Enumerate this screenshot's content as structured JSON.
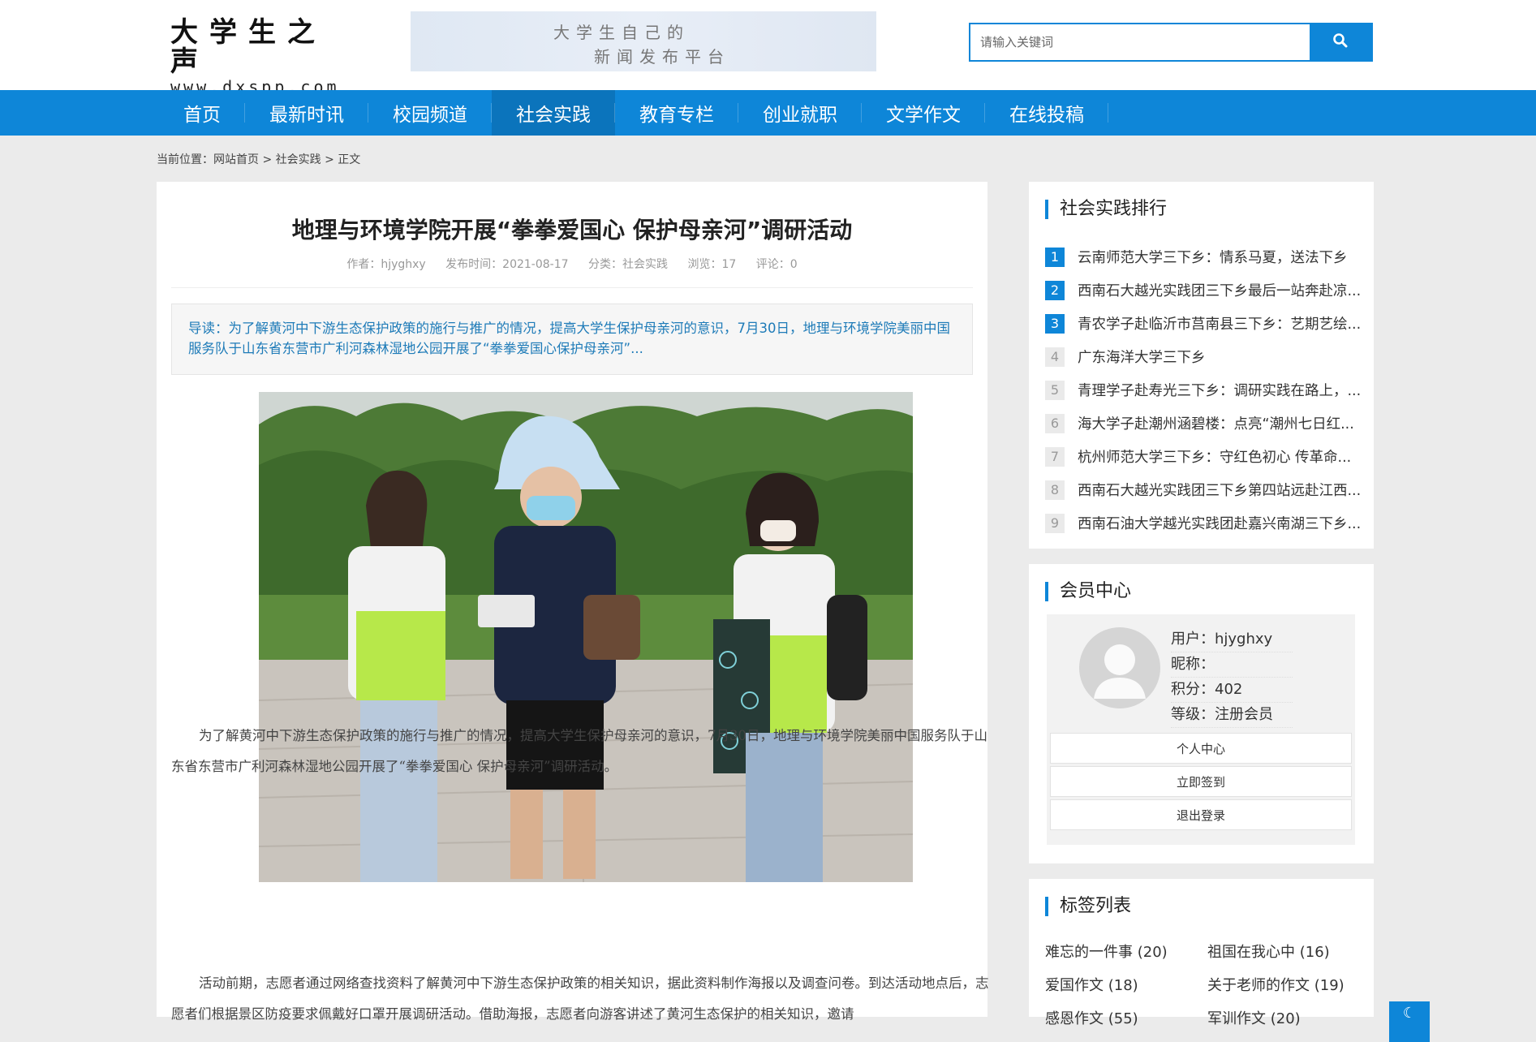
{
  "header": {
    "logo_title": "大学生之声",
    "logo_url": "www.dxspp.com",
    "banner_line1": "大学生自己的",
    "banner_line2": "新闻发布平台",
    "search_placeholder": "请输入关键词",
    "search_icon": "search-icon"
  },
  "nav": {
    "items": [
      "首页",
      "最新时讯",
      "校园频道",
      "社会实践",
      "教育专栏",
      "创业就职",
      "文学作文",
      "在线投稿"
    ],
    "active": "社会实践"
  },
  "breadcrumb": {
    "prefix": "当前位置：",
    "home": "网站首页",
    "sep1": ">",
    "category": "社会实践",
    "sep2": ">",
    "current": "正文"
  },
  "article": {
    "title": "地理与环境学院开展“拳拳爱国心 保护母亲河”调研活动",
    "meta": {
      "author": "作者：hjyghxy",
      "date": "发布时间：2021-08-17",
      "category": "分类：社会实践",
      "views": "浏览：17",
      "comments": "评论：0"
    },
    "summary": "导读：为了解黄河中下游生态保护政策的施行与推广的情况，提高大学生保护母亲河的意识，7月30日，地理与环境学院美丽中国服务队于山东省东营市广利河森林湿地公园开展了“拳拳爱国心保护母亲河”...",
    "paragraph1": "为了解黄河中下游生态保护政策的施行与推广的情况，提高大学生保护母亲河的意识，7月30日，地理与环境学院美丽中国服务队于山东省东营市广利河森林湿地公园开展了“拳拳爱国心 保护母亲河”调研活动。",
    "paragraph2": "活动前期，志愿者通过网络查找资料了解黄河中下游生态保护政策的相关知识，据此资料制作海报以及调查问卷。到达活动地点后，志愿者们根据景区防疫要求佩戴好口罩开展调研活动。借助海报，志愿者向游客讲述了黄河生态保护的相关知识，邀请"
  },
  "sidebar": {
    "ranking": {
      "title": "社会实践排行",
      "items": [
        {
          "num": "1",
          "text": "云南师范大学三下乡：情系马夏，送法下乡"
        },
        {
          "num": "2",
          "text": "西南石大越光实践团三下乡最后一站奔赴凉..."
        },
        {
          "num": "3",
          "text": "青农学子赴临沂市莒南县三下乡：艺期艺绘..."
        },
        {
          "num": "4",
          "text": "广东海洋大学三下乡"
        },
        {
          "num": "5",
          "text": "青理学子赴寿光三下乡：调研实践在路上，..."
        },
        {
          "num": "6",
          "text": "海大学子赴潮州涵碧楼：点亮“潮州七日红..."
        },
        {
          "num": "7",
          "text": "杭州师范大学三下乡：守红色初心 传革命..."
        },
        {
          "num": "8",
          "text": "西南石大越光实践团三下乡第四站远赴江西..."
        },
        {
          "num": "9",
          "text": "西南石油大学越光实践团赴嘉兴南湖三下乡..."
        }
      ]
    },
    "member": {
      "title": "会员中心",
      "user": "用户：hjyghxy",
      "nickname": "昵称：",
      "points": "积分：402",
      "level": "等级：注册会员",
      "btn_center": "个人中心",
      "btn_checkin": "立即签到",
      "btn_logout": "退出登录"
    },
    "tags": {
      "title": "标签列表",
      "items": [
        "难忘的一件事 (20)",
        "祖国在我心中 (16)",
        "爱国作文 (18)",
        "关于老师的作文 (19)",
        "感恩作文 (55)",
        "军训作文 (20)"
      ]
    }
  },
  "float_button": "☾",
  "colors": {
    "brand_blue": "#0e86d8",
    "nav_active": "#0b74bc",
    "summary_text": "#1e7bb8"
  }
}
